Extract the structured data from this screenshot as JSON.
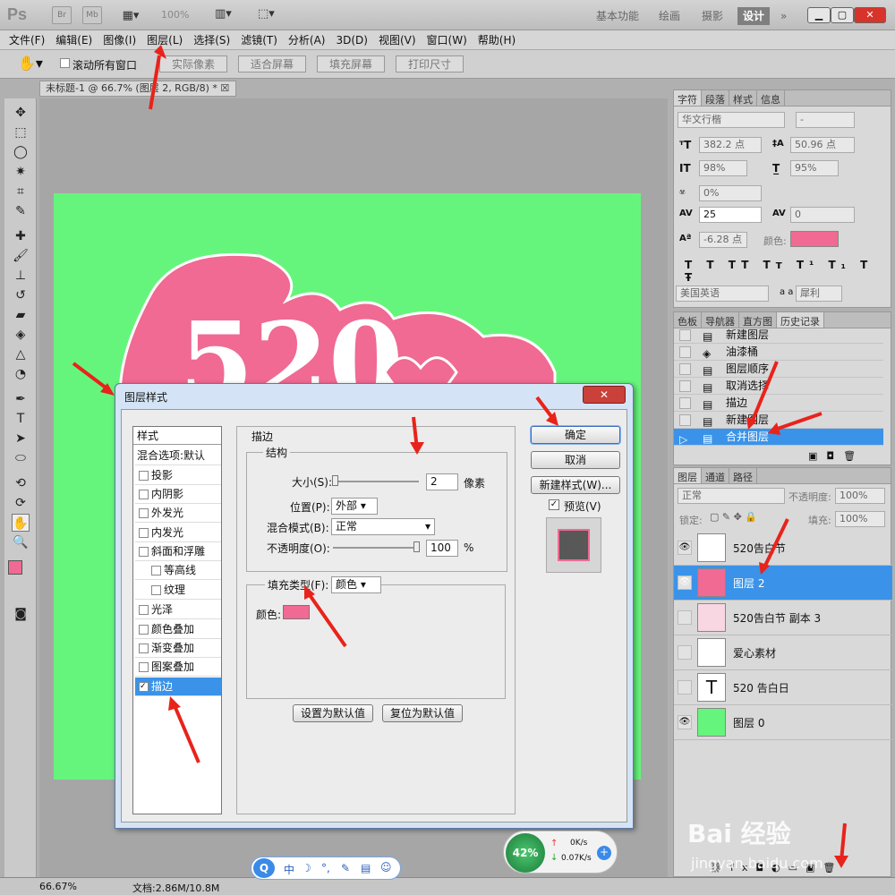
{
  "app": {
    "logo": "Ps",
    "bridge": "Br",
    "minibridge": "Mb",
    "zoom": "100%"
  },
  "workspaces": [
    "基本功能",
    "绘画",
    "摄影",
    "设计",
    "»"
  ],
  "menu": [
    "文件(F)",
    "编辑(E)",
    "图像(I)",
    "图层(L)",
    "选择(S)",
    "滤镜(T)",
    "分析(A)",
    "3D(D)",
    "视图(V)",
    "窗口(W)",
    "帮助(H)"
  ],
  "options": {
    "scroll_all": "滚动所有窗口",
    "actual": "实际像素",
    "fit": "适合屏幕",
    "fill": "填充屏幕",
    "print": "打印尺寸"
  },
  "document": {
    "tab": "未标题-1 @ 66.7% (图层 2, RGB/8) *",
    "zoom": "66.67%",
    "docsize": "文档:2.86M/10.8M"
  },
  "char_panel": {
    "tabs": [
      "字符",
      "段落",
      "样式",
      "信息"
    ],
    "font": "华文行楷",
    "style": "-",
    "size": "382.2 点",
    "leading": "50.96 点",
    "vscale": "98%",
    "hscale": "95%",
    "tsume": "0%",
    "kerning": "25",
    "tracking": "0",
    "baseline": "-6.28 点",
    "color_label": "颜色:",
    "language": "美国英语",
    "aa_label": "a a",
    "aa": "犀利",
    "color": "#f06a93"
  },
  "history_panel": {
    "tabs": [
      "色板",
      "导航器",
      "直方图",
      "历史记录"
    ],
    "items": [
      "新建图层",
      "油漆桶",
      "图层顺序",
      "取消选择",
      "描边",
      "新建图层",
      "合并图层"
    ]
  },
  "layers_panel": {
    "tabs": [
      "图层",
      "通道",
      "路径"
    ],
    "blend": "正常",
    "opacity_label": "不透明度:",
    "opacity": "100%",
    "lock_label": "锁定:",
    "fill_label": "填充:",
    "fill": "100%",
    "layers": [
      {
        "name": "520告白节",
        "visible": true
      },
      {
        "name": "图层 2",
        "visible": true,
        "selected": true
      },
      {
        "name": "520告白节 副本 3",
        "visible": false
      },
      {
        "name": "爱心素材",
        "visible": false
      },
      {
        "name": "520      告白日",
        "visible": false,
        "text": "T"
      },
      {
        "name": "图层 0",
        "visible": true
      }
    ]
  },
  "dialog": {
    "title": "图层样式",
    "styles_header": "样式",
    "styles": [
      "混合选项:默认",
      "投影",
      "内阴影",
      "外发光",
      "内发光",
      "斜面和浮雕",
      "等高线",
      "纹理",
      "光泽",
      "颜色叠加",
      "渐变叠加",
      "图案叠加",
      "描边"
    ],
    "section": "描边",
    "structure": "结构",
    "size_label": "大小(S):",
    "size": "2",
    "px": "像素",
    "position_label": "位置(P):",
    "position": "外部",
    "blend_label": "混合模式(B):",
    "blend": "正常",
    "opacity_label": "不透明度(O):",
    "opacity": "100",
    "pct": "%",
    "fill_type_label": "填充类型(F):",
    "fill_type": "颜色",
    "color_label": "颜色:",
    "ok": "确定",
    "cancel": "取消",
    "new_style": "新建样式(W)...",
    "preview": "预览(V)",
    "set_default": "设置为默认值",
    "reset_default": "复位为默认值"
  },
  "netmon": {
    "percent": "42%",
    "up": "0K/s",
    "down": "0.07K/s"
  },
  "ime": {
    "items": [
      "中",
      "☽",
      "°,",
      "✎",
      "▤",
      "☺"
    ]
  },
  "watermark": {
    "brand": "Bai 经验",
    "url": "jingyan.baidu.com"
  },
  "canvas_text": "520"
}
